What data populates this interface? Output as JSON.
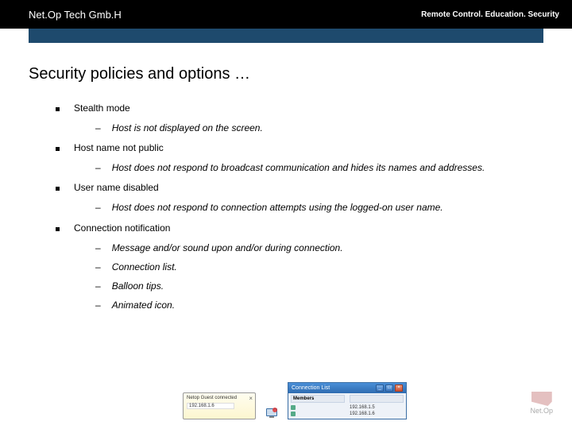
{
  "header": {
    "company": "Net.Op Tech Gmb.H",
    "tagline": "Remote Control. Education. Security"
  },
  "title": "Security policies and options …",
  "bullets": [
    {
      "label": "Stealth mode",
      "subs": [
        "Host is not displayed on the screen."
      ]
    },
    {
      "label": "Host name not public",
      "subs": [
        "Host does not respond to broadcast communication and hides its names and addresses."
      ]
    },
    {
      "label": "User name disabled",
      "subs": [
        "Host does not respond to connection attempts using the logged-on user name."
      ]
    },
    {
      "label": "Connection notification",
      "subs": [
        "Message and/or sound upon and/or during connection.",
        "Connection list.",
        "Balloon tips.",
        "Animated icon."
      ]
    }
  ],
  "balloon": {
    "title": "Netop Guest connected",
    "line": "192.168.1.6"
  },
  "connlist": {
    "title": "Connection List",
    "col1": "Members",
    "col2": "",
    "rows": [
      {
        "a": "",
        "b": "192.168.1.5"
      },
      {
        "a": "",
        "b": "192.168.1.6"
      }
    ]
  },
  "logo": {
    "text": "Net.Op",
    "sub": ""
  }
}
